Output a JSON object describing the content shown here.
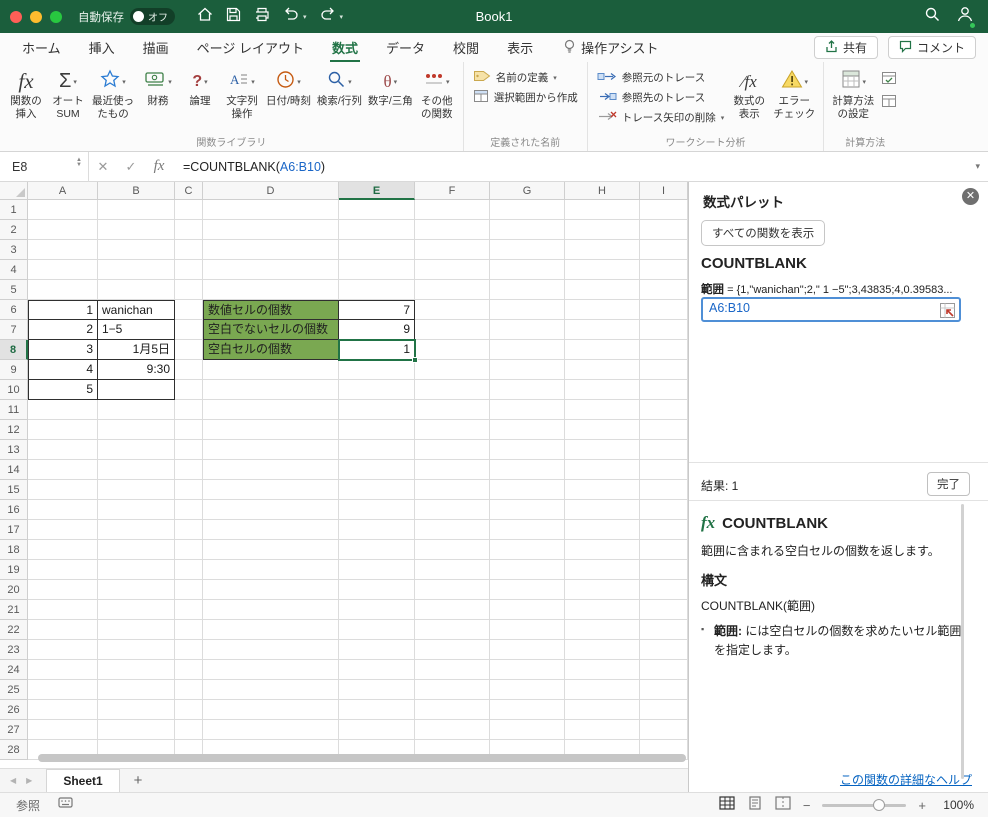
{
  "colors": {
    "accent": "#217346",
    "range_blue": "#1a66c7",
    "cell_green": "#7aa851",
    "input_border": "#4f8fd6"
  },
  "titlebar": {
    "autosave_label": "自動保存",
    "autosave_state": "オフ",
    "title": "Book1"
  },
  "tabs": {
    "items": [
      "ホーム",
      "挿入",
      "描画",
      "ページ レイアウト",
      "数式",
      "データ",
      "校閲",
      "表示"
    ],
    "active": "数式",
    "assistant": "操作アシスト",
    "share": "共有",
    "comment": "コメント"
  },
  "ribbon": {
    "lib": {
      "label": "関数ライブラリ",
      "insert": {
        "l1": "関数の",
        "l2": "挿入"
      },
      "autosum": {
        "l1": "オート",
        "l2": "SUM"
      },
      "recent": {
        "l1": "最近使っ",
        "l2": "たもの"
      },
      "financial": {
        "l1": "財務"
      },
      "logical": {
        "l1": "論理"
      },
      "text": {
        "l1": "文字列",
        "l2": "操作"
      },
      "datetime": {
        "l1": "日付/時刻"
      },
      "lookup": {
        "l1": "検索/行列"
      },
      "math": {
        "l1": "数字/三角"
      },
      "more": {
        "l1": "その他",
        "l2": "の関数"
      }
    },
    "names": {
      "label": "定義された名前",
      "define": "名前の定義",
      "create": "選択範囲から作成"
    },
    "audit": {
      "label": "ワークシート分析",
      "precedents": "参照元のトレース",
      "dependents": "参照先のトレース",
      "remove": "トレース矢印の削除",
      "show_formulas": {
        "l1": "数式の",
        "l2": "表示"
      },
      "error_check": {
        "l1": "エラー",
        "l2": "チェック"
      }
    },
    "calc": {
      "label": "計算方法",
      "options": {
        "l1": "計算方法",
        "l2": "の設定"
      }
    }
  },
  "formula_bar": {
    "name_box": "E8",
    "prefix": "=COUNTBLANK(",
    "range": "A6:B10",
    "suffix": ")"
  },
  "grid": {
    "columns": [
      "A",
      "B",
      "C",
      "D",
      "E",
      "F",
      "G",
      "H",
      "I"
    ],
    "row_count": 28,
    "selected_column": "E",
    "selected_row": 8,
    "selected_cell": "E8",
    "cells": [
      {
        "ref": "A6",
        "text": "1",
        "align": "right"
      },
      {
        "ref": "B6",
        "text": "wanichan",
        "align": "left"
      },
      {
        "ref": "A7",
        "text": "2",
        "align": "right"
      },
      {
        "ref": "B7",
        "text": "1−5",
        "align": "left"
      },
      {
        "ref": "A8",
        "text": "3",
        "align": "right"
      },
      {
        "ref": "B8",
        "text": "1月5日",
        "align": "right"
      },
      {
        "ref": "A9",
        "text": "4",
        "align": "right"
      },
      {
        "ref": "B9",
        "text": "9:30",
        "align": "right"
      },
      {
        "ref": "A10",
        "text": "5",
        "align": "right"
      },
      {
        "ref": "B10",
        "text": "",
        "align": "left"
      },
      {
        "ref": "D6",
        "text": "数値セルの個数",
        "align": "left",
        "fill": "green"
      },
      {
        "ref": "E6",
        "text": "7",
        "align": "right"
      },
      {
        "ref": "D7",
        "text": "空白でないセルの個数",
        "align": "left",
        "fill": "green"
      },
      {
        "ref": "E7",
        "text": "9",
        "align": "right"
      },
      {
        "ref": "D8",
        "text": "空白セルの個数",
        "align": "left",
        "fill": "green"
      },
      {
        "ref": "E8",
        "text": "1",
        "align": "right"
      }
    ]
  },
  "panel": {
    "title": "数式パレット",
    "show_all": "すべての関数を表示",
    "function_name": "COUNTBLANK",
    "arg_label": "範囲",
    "arg_eq": "=",
    "arg_preview": "{1,\"wanichan\";2,\" 1 −5\";3,43835;4,0.39583...",
    "input_value": "A6:B10",
    "result": "結果: 1",
    "done": "完了",
    "fx": "fx",
    "doc_name": "COUNTBLANK",
    "description": "範囲に含まれる空白セルの個数を返します。",
    "syntax_label": "構文",
    "syntax": "COUNTBLANK(範囲)",
    "param_bold": "範囲:",
    "param_rest": "には空白セルの個数を求めたいセル範囲を指定します。",
    "help": "この関数の詳細なヘルプ"
  },
  "sheet_bar": {
    "sheet": "Sheet1",
    "add": "+"
  },
  "status_bar": {
    "mode": "参照",
    "zoom": "100%"
  }
}
